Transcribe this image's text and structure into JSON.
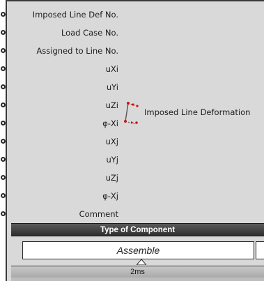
{
  "component": {
    "name": "Imposed Line Deformation",
    "icon": "imposed-line-deformation-icon",
    "inputs": [
      "Imposed Line Def No.",
      "Load Case No.",
      "Assigned to Line No.",
      "uXi",
      "uYi",
      "uZi",
      "φ-Xi",
      "uXj",
      "uYj",
      "uZj",
      "φ-Xj",
      "Comment"
    ],
    "type_header": "Type of Component",
    "type_value": "Assemble",
    "timing": "2ms"
  },
  "colors": {
    "body": "#d9d9d9",
    "header_bar": "#3a3a3a",
    "icon_red": "#cc1111"
  }
}
